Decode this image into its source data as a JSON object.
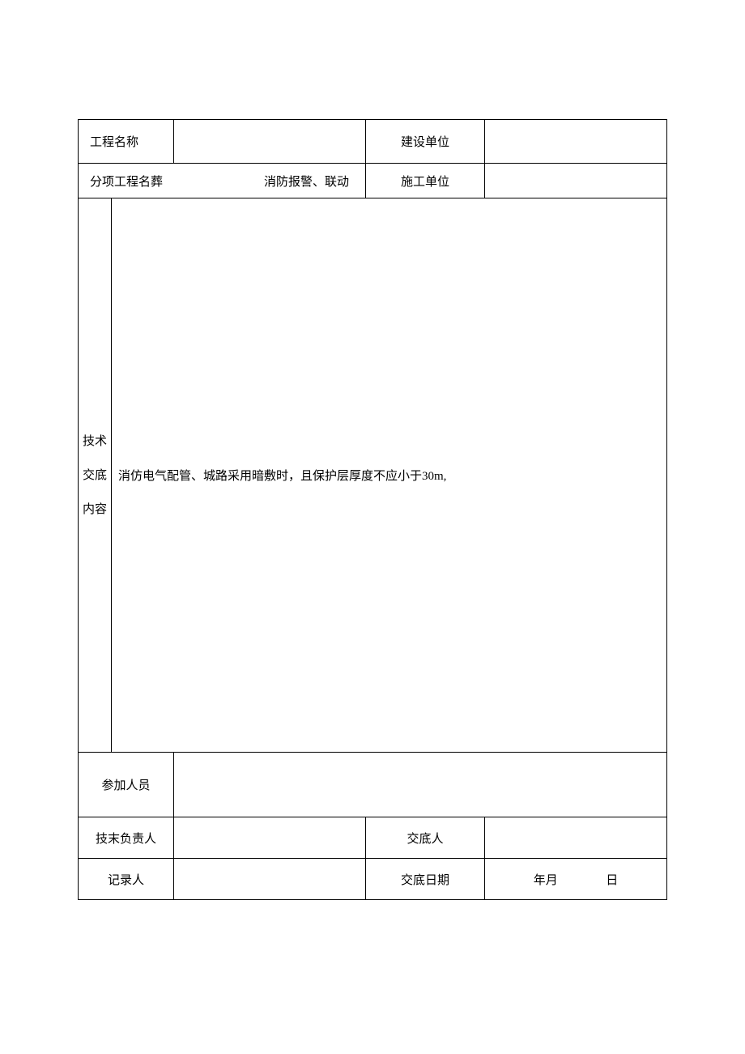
{
  "row1": {
    "label1": "工程名称",
    "value1": "",
    "label2": "建设单位",
    "value2": ""
  },
  "row2": {
    "label1": "分项工程名葬",
    "value1": "消防报警、联动",
    "label2": "施工单位",
    "value2": ""
  },
  "content": {
    "vertical_label": "技术交底内容",
    "vertical_label_line1": "技术",
    "vertical_label_line2": "交底",
    "vertical_label_line3": "内容",
    "body": "消仿电气配管、城路采用暗敷时，且保护层厚度不应小于30m,"
  },
  "participants": {
    "label": "参加人员",
    "value": ""
  },
  "row_tech": {
    "label1": "技末负责人",
    "value1": "",
    "label2": "交底人",
    "value2": ""
  },
  "row_record": {
    "label1": "记录人",
    "value1": "",
    "label2": "交底日期",
    "date_ym": "年月",
    "date_d": "日"
  }
}
